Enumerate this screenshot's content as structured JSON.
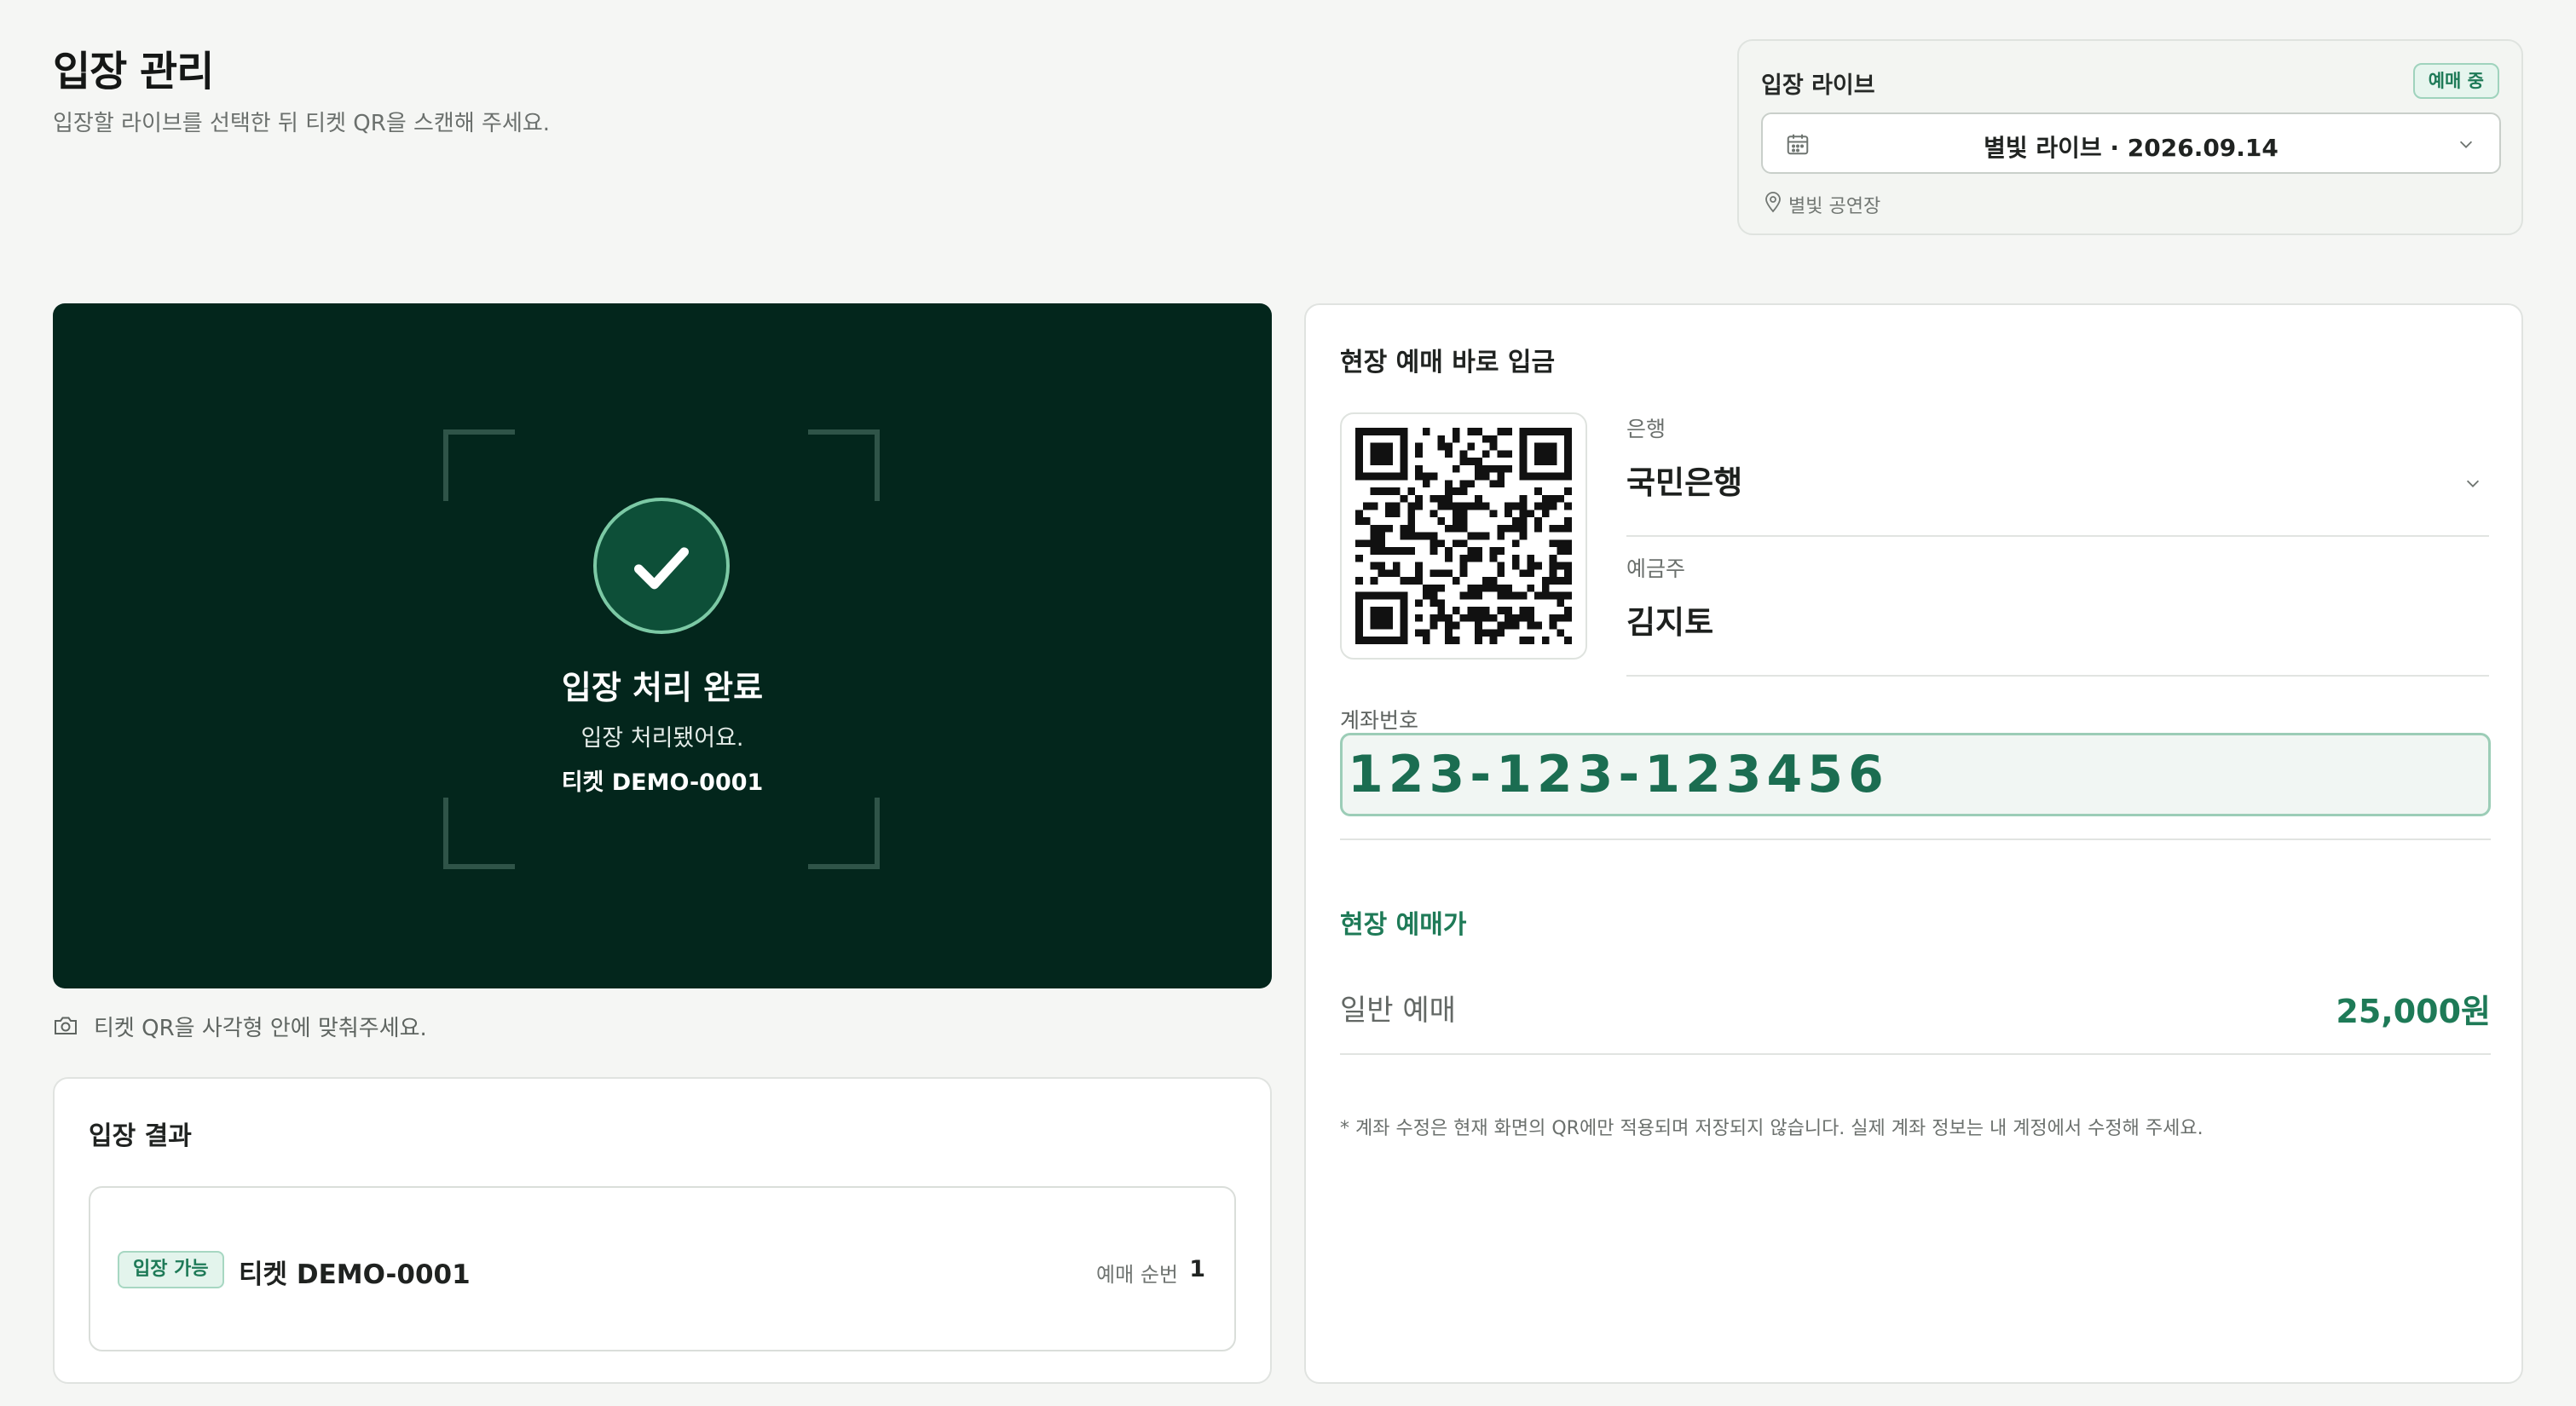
{
  "header": {
    "title": "입장 관리",
    "subtitle": "입장할 라이브를 선택한 뒤 티켓 QR을 스캔해 주세요."
  },
  "live_selector": {
    "label": "입장 라이브",
    "status_badge": "예매 중",
    "selected_live": "별빛 라이브 · 2026.09.14",
    "venue": "별빛 공연장"
  },
  "scanner": {
    "status_title": "입장 처리 완료",
    "message": "입장 처리됐어요.",
    "ticket": "티켓 DEMO-0001",
    "hint": "티켓 QR을 사각형 안에 맞춰주세요."
  },
  "entry_result": {
    "title": "입장 결과",
    "badge": "입장 가능",
    "ticket": "티켓 DEMO-0001",
    "order_label": "예매 순번",
    "order_value": "1"
  },
  "deposit": {
    "title": "현장 예매 바로 입금",
    "bank_label": "은행",
    "bank_value": "국민은행",
    "holder_label": "예금주",
    "holder_value": "김지토",
    "account_label": "계좌번호",
    "account_value": "123-123-123456",
    "price_heading": "현장 예매가",
    "price_name": "일반 예매",
    "price_value": "25,000원",
    "notice": "* 계좌 수정은 현재 화면의 QR에만 적용되며 저장되지 않습니다. 실제 계좌 정보는 내 계정에서 수정해 주세요."
  },
  "colors": {
    "accent": "#1e7a57",
    "scanner_bg": "#03261c",
    "page_bg": "#f5f6f4"
  }
}
